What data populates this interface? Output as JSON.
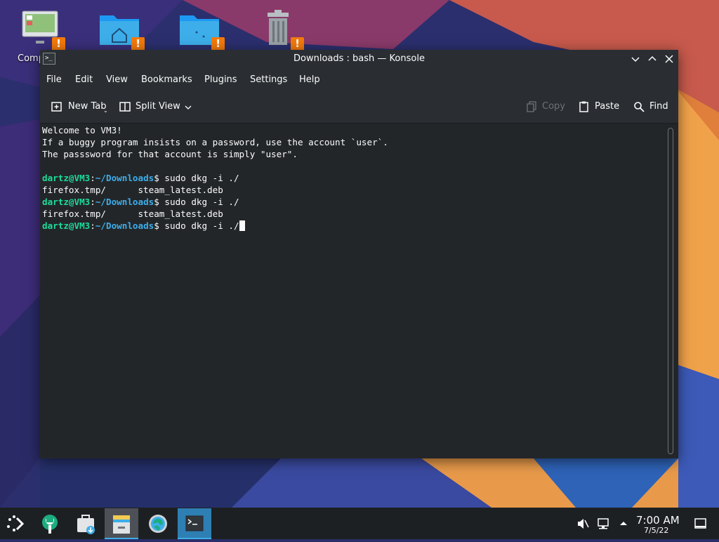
{
  "colors": {
    "accent": "#3daee9",
    "terminal_bg": "#232629",
    "prompt_user": "#1cdc9a",
    "prompt_path": "#3daee9",
    "warning": "#f47a0b"
  },
  "desktop": {
    "icons": [
      {
        "icon": "computer-icon",
        "label": "Comp"
      },
      {
        "icon": "home-folder-icon",
        "label": ""
      },
      {
        "icon": "network-folder-icon",
        "label": ""
      },
      {
        "icon": "trash-icon",
        "label": ""
      }
    ]
  },
  "window": {
    "title": "Downloads : bash — Konsole",
    "menu": [
      "File",
      "Edit",
      "View",
      "Bookmarks",
      "Plugins",
      "Settings",
      "Help"
    ],
    "toolbar": {
      "new_tab": "New Tab",
      "split_view": "Split View",
      "copy": "Copy",
      "paste": "Paste",
      "find": "Find"
    }
  },
  "terminal": {
    "welcome": [
      "Welcome to VM3!",
      "If a buggy program insists on a password, use the account `user`.",
      "The passsword for that account is simply \"user\"."
    ],
    "prompt_user": "dartz@VM3",
    "prompt_sep": ":",
    "prompt_path": "~/Downloads",
    "prompt_suffix": "$ ",
    "command": "sudo dkg -i ./",
    "listing": "firefox.tmp/      steam_latest.deb"
  },
  "taskbar": {
    "items": [
      "app-launcher-icon",
      "discover-icon",
      "store-icon",
      "file-manager-icon",
      "settings-icon",
      "konsole-icon"
    ],
    "clock": {
      "time": "7:00 AM",
      "date": "7/5/22"
    }
  }
}
